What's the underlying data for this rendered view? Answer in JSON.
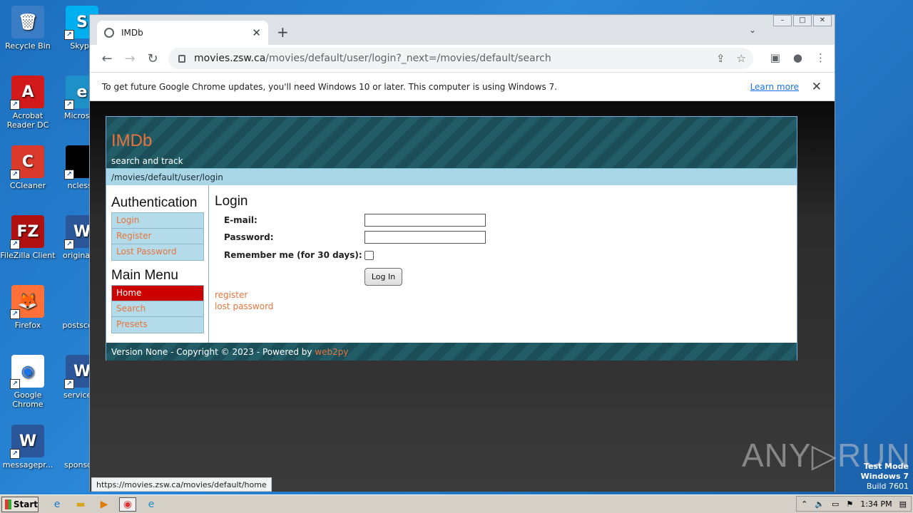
{
  "desktop": {
    "icons": [
      {
        "label": "Recycle Bin",
        "glyph": "🗑",
        "bg": "#3b7dc4"
      },
      {
        "label": "Skype",
        "glyph": "S",
        "bg": "#00aff0"
      },
      {
        "label": "Acrobat Reader DC",
        "glyph": "A",
        "bg": "#d21a1a"
      },
      {
        "label": "Microsoft",
        "glyph": "e",
        "bg": "#1e90c8"
      },
      {
        "label": "CCleaner",
        "glyph": "C",
        "bg": "#d93a2b"
      },
      {
        "label": "ncless.j",
        "glyph": "",
        "bg": "#000000"
      },
      {
        "label": "FileZilla Client",
        "glyph": "FZ",
        "bg": "#b01010"
      },
      {
        "label": "originalce",
        "glyph": "W",
        "bg": "#2b579a"
      },
      {
        "label": "Firefox",
        "glyph": "🦊",
        "bg": "#ff7139"
      },
      {
        "label": "postscons",
        "glyph": "",
        "bg": "transparent"
      },
      {
        "label": "Google Chrome",
        "glyph": "◉",
        "bg": "#ffffff"
      },
      {
        "label": "servicesp",
        "glyph": "W",
        "bg": "#2b579a"
      },
      {
        "label": "messagepr...",
        "glyph": "W",
        "bg": "#2b579a"
      },
      {
        "label": "sponsore",
        "glyph": "",
        "bg": "transparent"
      }
    ]
  },
  "browser": {
    "tab_title": "IMDb",
    "new_tab": "+",
    "url_host": "movies.zsw.ca",
    "url_path": "/movies/default/user/login?_next=/movies/default/search",
    "infobar_text": "To get future Google Chrome updates, you'll need Windows 10 or later. This computer is using Windows 7.",
    "learn_more": "Learn more",
    "status_url": "https://movies.zsw.ca/movies/default/home"
  },
  "site": {
    "logo": "IMDb",
    "slogan": "search and track",
    "breadcrumb": "/movies/default/user/login",
    "auth_heading": "Authentication",
    "auth_menu": [
      "Login",
      "Register",
      "Lost Password"
    ],
    "main_heading": "Main Menu",
    "main_menu": [
      "Home",
      "Search",
      "Presets"
    ],
    "form_title": "Login",
    "email_label": "E-mail:",
    "password_label": "Password:",
    "remember_label": "Remember me (for 30 days):",
    "login_button": "Log In",
    "register_link": "register",
    "lost_password_link": "lost password",
    "footer_text": "Version None - Copyright © 2023 - Powered by ",
    "footer_link": "web2py"
  },
  "overlay": {
    "watermark": "ANY▷RUN",
    "test_mode": "Test Mode",
    "windows": "Windows 7",
    "build": "Build 7601"
  },
  "taskbar": {
    "start": "Start",
    "clock": "1:34 PM"
  }
}
